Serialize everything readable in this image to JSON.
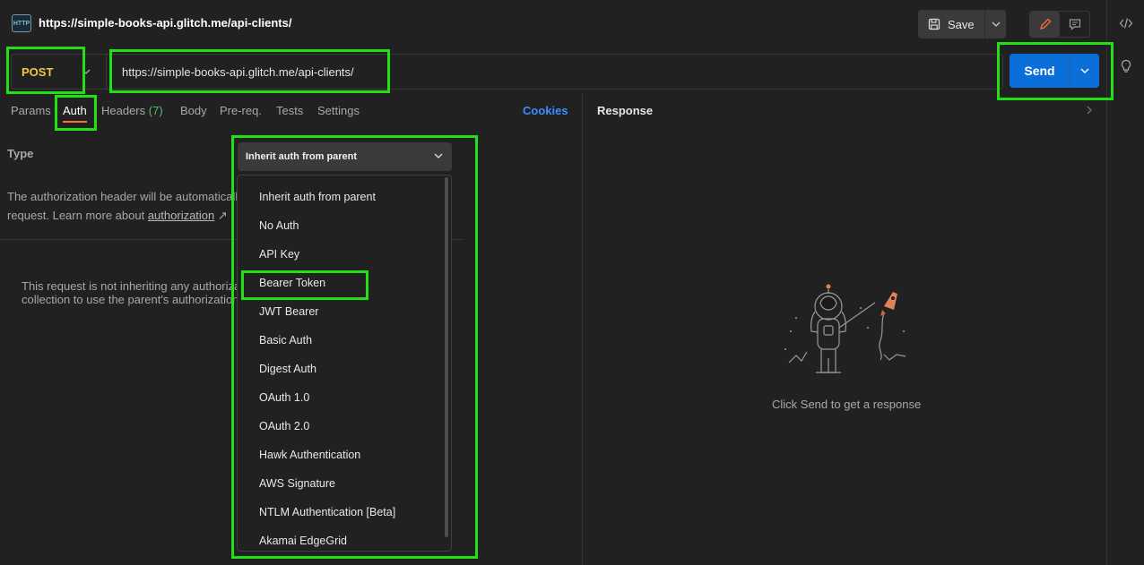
{
  "request": {
    "badge": "HTTP",
    "title": "https://simple-books-api.glitch.me/api-clients/",
    "method": "POST",
    "url": "https://simple-books-api.glitch.me/api-clients/"
  },
  "toolbar": {
    "save_label": "Save",
    "send_label": "Send"
  },
  "tabs": [
    {
      "label": "Params"
    },
    {
      "label": "Auth"
    },
    {
      "label": "Headers"
    },
    {
      "label": "Body"
    },
    {
      "label": "Pre-req."
    },
    {
      "label": "Tests"
    },
    {
      "label": "Settings"
    }
  ],
  "headers_count": "(7)",
  "cookies_label": "Cookies",
  "auth": {
    "type_label": "Type",
    "selected": "Inherit auth from parent",
    "desc_line1": "The authorization header will be automatically",
    "desc_line2_prefix": "request. Learn more about ",
    "desc_link": "authorization",
    "desc_link_suffix": " ↗",
    "note_line1": "This request is not inheriting any authorization",
    "note_line2": "collection to use the parent's authorization"
  },
  "auth_options": [
    "Inherit auth from parent",
    "No Auth",
    "API Key",
    "Bearer Token",
    "JWT Bearer",
    "Basic Auth",
    "Digest Auth",
    "OAuth 1.0",
    "OAuth 2.0",
    "Hawk Authentication",
    "AWS Signature",
    "NTLM Authentication [Beta]",
    "Akamai EdgeGrid"
  ],
  "response": {
    "title": "Response",
    "empty_text": "Click Send to get a response"
  },
  "colors": {
    "method": "#f2c744",
    "send": "#0b6fd9",
    "cookies": "#3e8bff",
    "tab_underline": "#ff6c37",
    "highlight": "#22e014"
  }
}
